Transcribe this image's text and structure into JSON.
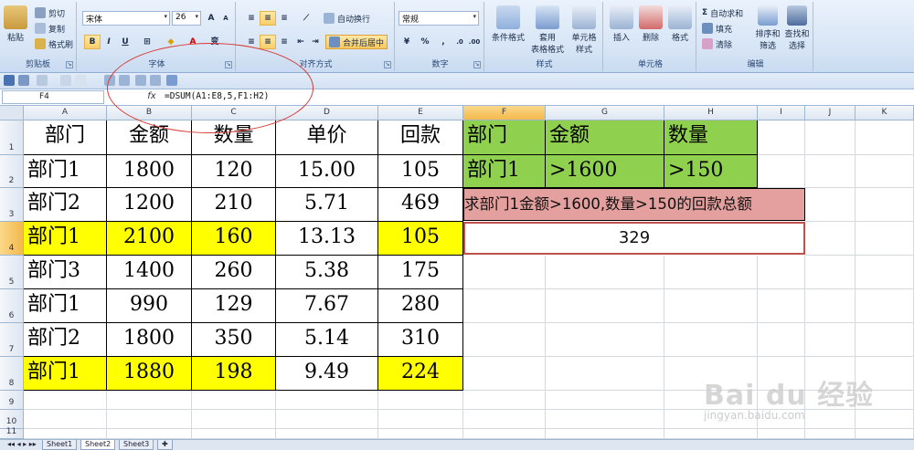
{
  "ribbon": {
    "clipboard": {
      "paste": "粘贴",
      "cut": "剪切",
      "copy": "复制",
      "format_painter": "格式刷",
      "group": "剪贴板"
    },
    "font": {
      "name": "宋体",
      "size": "26",
      "bold": "B",
      "italic": "I",
      "underline": "U",
      "group": "字体"
    },
    "alignment": {
      "wrap": "自动换行",
      "merge": "合并后居中",
      "group": "对齐方式"
    },
    "number": {
      "format": "常规",
      "percent": "%",
      "comma": ",",
      "group": "数字"
    },
    "styles": {
      "conditional": "条件格式",
      "table": "套用\n表格格式",
      "cell_styles": "单元格\n样式",
      "group": "样式"
    },
    "cells": {
      "insert": "插入",
      "delete": "删除",
      "format": "格式",
      "group": "单元格"
    },
    "editing": {
      "autosum": "自动求和",
      "fill": "填充",
      "clear": "清除",
      "sort": "排序和\n筛选",
      "find": "查找和\n选择",
      "group": "编辑"
    }
  },
  "formula_bar": {
    "name_box": "F4",
    "fx": "fx",
    "formula": "=DSUM(A1:E8,5,F1:H2)"
  },
  "columns": [
    "A",
    "B",
    "C",
    "D",
    "E",
    "F",
    "G",
    "H",
    "I",
    "J",
    "K"
  ],
  "rows": [
    "1",
    "2",
    "3",
    "4",
    "5",
    "6",
    "7",
    "8",
    "9",
    "10",
    "11"
  ],
  "table": {
    "headers": [
      "部门",
      "金额",
      "数量",
      "单价",
      "回款"
    ],
    "rows": [
      [
        "部门1",
        "1800",
        "120",
        "15.00",
        "105"
      ],
      [
        "部门2",
        "1200",
        "210",
        "5.71",
        "469"
      ],
      [
        "部门1",
        "2100",
        "160",
        "13.13",
        "105"
      ],
      [
        "部门3",
        "1400",
        "260",
        "5.38",
        "175"
      ],
      [
        "部门1",
        "990",
        "129",
        "7.67",
        "280"
      ],
      [
        "部门2",
        "1800",
        "350",
        "5.14",
        "310"
      ],
      [
        "部门1",
        "1880",
        "198",
        "9.49",
        "224"
      ]
    ]
  },
  "criteria": {
    "headers": [
      "部门",
      "金额",
      "数量"
    ],
    "values": [
      "部门1",
      ">1600",
      ">150"
    ]
  },
  "note": "求部门1金额>1600,数量>150的回款总额",
  "result": "329",
  "sheets": [
    "Sheet1",
    "Sheet2",
    "Sheet3"
  ],
  "watermark": {
    "brand": "Bai du 经验",
    "url": "jingyan.baidu.com"
  },
  "colors": {
    "highlight": "#ffff00",
    "criteria": "#8fd14f",
    "note": "#e4a09e",
    "annotation": "#d93a36"
  }
}
